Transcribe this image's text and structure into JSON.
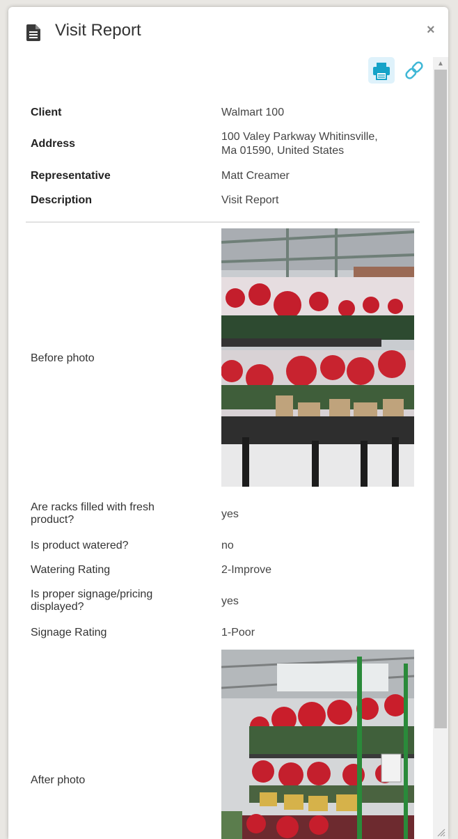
{
  "dialog": {
    "title": "Visit Report",
    "icons": {
      "title": "document-icon",
      "close": "close-icon",
      "print": "printer-icon",
      "link": "link-icon"
    },
    "close_label": "×",
    "accent_color": "#16a3c8"
  },
  "details": [
    {
      "label": "Client",
      "value": "Walmart 100"
    },
    {
      "label": "Address",
      "value_line1": "100 Valey Parkway Whitinsville,",
      "value_line2": "Ma 01590, United States"
    },
    {
      "label": "Representative",
      "value": "Matt Creamer"
    },
    {
      "label": "Description",
      "value": "Visit Report"
    }
  ],
  "fields": {
    "before_photo": {
      "label": "Before photo"
    },
    "racks": {
      "label_line1": "Are racks filled with fresh",
      "label_line2": "product?",
      "value": "yes"
    },
    "watered": {
      "label": "Is product watered?",
      "value": "no"
    },
    "watering_rating": {
      "label": "Watering Rating",
      "value": "2-Improve"
    },
    "signage": {
      "label_line1": "Is proper signage/pricing",
      "label_line2": "displayed?",
      "value": "yes"
    },
    "signage_rating": {
      "label": "Signage Rating",
      "value": "1-Poor"
    },
    "after_photo": {
      "label": "After photo"
    }
  }
}
